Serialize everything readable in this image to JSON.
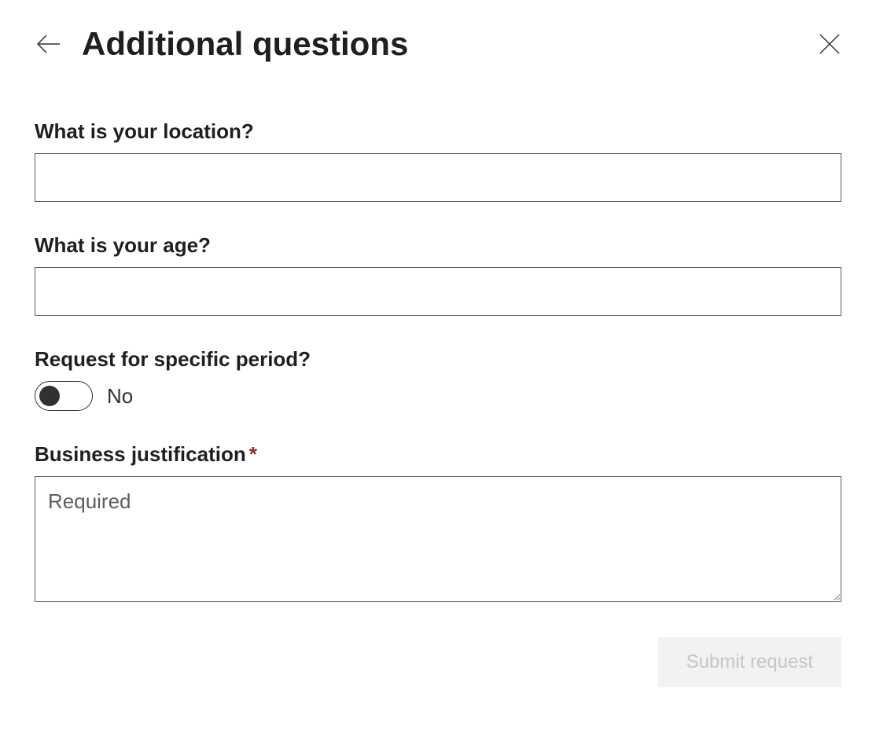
{
  "header": {
    "title": "Additional questions"
  },
  "form": {
    "location": {
      "label": "What is your location?",
      "value": ""
    },
    "age": {
      "label": "What is your age?",
      "value": ""
    },
    "period": {
      "label": "Request for specific period?",
      "toggle_state": "No"
    },
    "justification": {
      "label": "Business justification",
      "required_mark": "*",
      "placeholder": "Required",
      "value": ""
    }
  },
  "actions": {
    "submit_label": "Submit request"
  }
}
